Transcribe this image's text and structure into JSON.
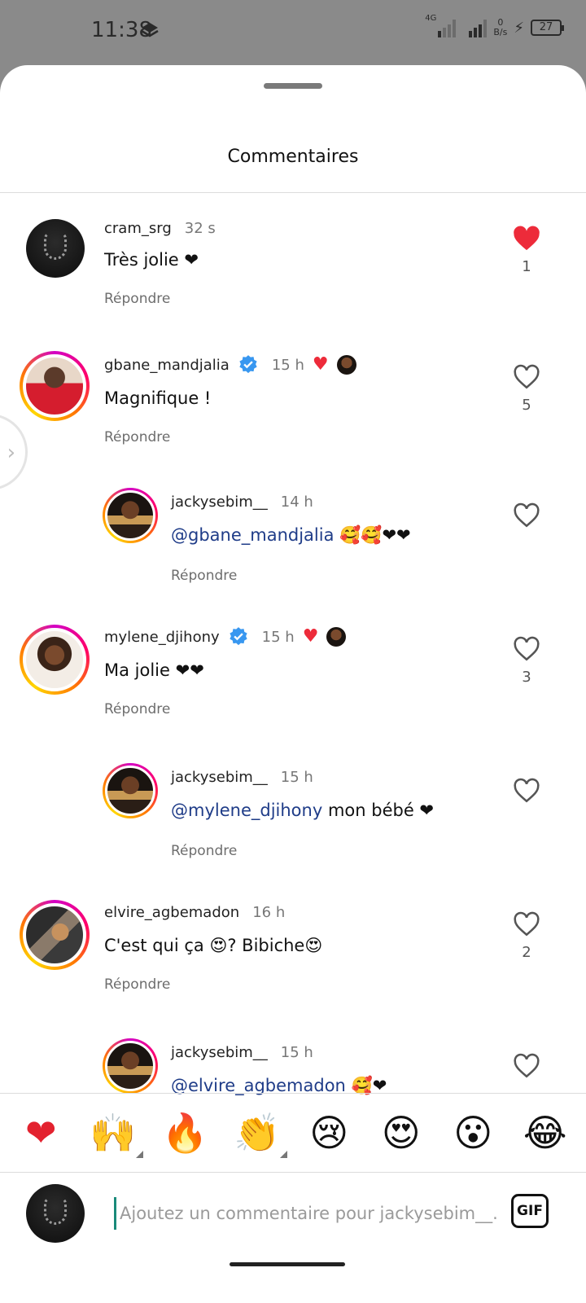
{
  "status_bar": {
    "time": "11:38",
    "network": "4G",
    "speed_value": "0",
    "speed_unit": "B/s",
    "battery": "27"
  },
  "sheet": {
    "title": "Commentaires"
  },
  "comments": [
    {
      "username": "cram_srg",
      "time": "32 s",
      "text": "Très jolie ❤",
      "reply_label": "Répondre",
      "likes": "1",
      "liked": true,
      "verified": false,
      "creator_liked": false
    },
    {
      "username": "gbane_mandjalia",
      "time": "15 h",
      "text": "Magnifique !",
      "reply_label": "Répondre",
      "likes": "5",
      "liked": false,
      "verified": true,
      "creator_liked": true
    },
    {
      "username": "jackysebim__",
      "time": "14 h",
      "mention": "@gbane_mandjalia",
      "text": "🥰🥰❤❤",
      "reply_label": "Répondre",
      "likes": "",
      "liked": false,
      "is_reply": true
    },
    {
      "username": "mylene_djihony",
      "time": "15 h",
      "text": "Ma jolie ❤❤",
      "reply_label": "Répondre",
      "likes": "3",
      "liked": false,
      "verified": true,
      "creator_liked": true
    },
    {
      "username": "jackysebim__",
      "time": "15 h",
      "mention": "@mylene_djihony",
      "text": "mon bébé ❤",
      "reply_label": "Répondre",
      "likes": "",
      "liked": false,
      "is_reply": true
    },
    {
      "username": "elvire_agbemadon",
      "time": "16 h",
      "text": "C'est qui ça 😍? Bibiche😍",
      "reply_label": "Répondre",
      "likes": "2",
      "liked": false,
      "verified": false,
      "creator_liked": false
    },
    {
      "username": "jackysebim__",
      "time": "15 h",
      "mention": "@elvire_agbemadon",
      "text": "🥰❤",
      "reply_label": "",
      "likes": "",
      "liked": false,
      "is_reply": true
    }
  ],
  "emoji_bar": [
    "❤",
    "🙌",
    "🔥",
    "👏",
    "😢",
    "😍",
    "😮",
    "😂"
  ],
  "input": {
    "placeholder": "Ajoutez un commentaire pour jackysebim__...",
    "gif_label": "GIF"
  },
  "colors": {
    "like_red": "#ed2b3a",
    "mention_blue": "#1f3c88",
    "verified_blue": "#3897f0"
  }
}
